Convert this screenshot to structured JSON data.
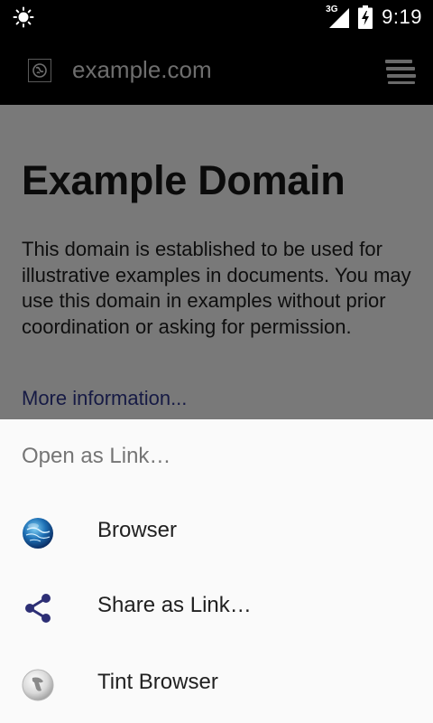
{
  "status_bar": {
    "network_type": "3G",
    "time": "9:19",
    "icons": [
      "brightness-icon",
      "signal-icon",
      "battery-charging-icon"
    ]
  },
  "toolbar": {
    "url": "example.com",
    "icons": [
      "globe-favicon-icon",
      "tabs-icon"
    ]
  },
  "web_page": {
    "heading": "Example Domain",
    "paragraph": "This domain is established to be used for illustrative examples in documents. You may use this domain in examples without prior coordination or asking for permission.",
    "link": "More information..."
  },
  "share_sheet": {
    "title": "Open as Link…",
    "items": [
      {
        "label": "Browser",
        "icon": "browser-globe-icon"
      },
      {
        "label": "Share as Link…",
        "icon": "share-icon"
      },
      {
        "label": "Tint Browser",
        "icon": "tint-browser-icon"
      }
    ]
  },
  "colors": {
    "status_bar_bg": "#000000",
    "toolbar_bg": "#000000",
    "dim_overlay_page": "#797979",
    "sheet_bg": "#fafafa",
    "share_icon": "#2d2f75",
    "link": "#161a44"
  }
}
